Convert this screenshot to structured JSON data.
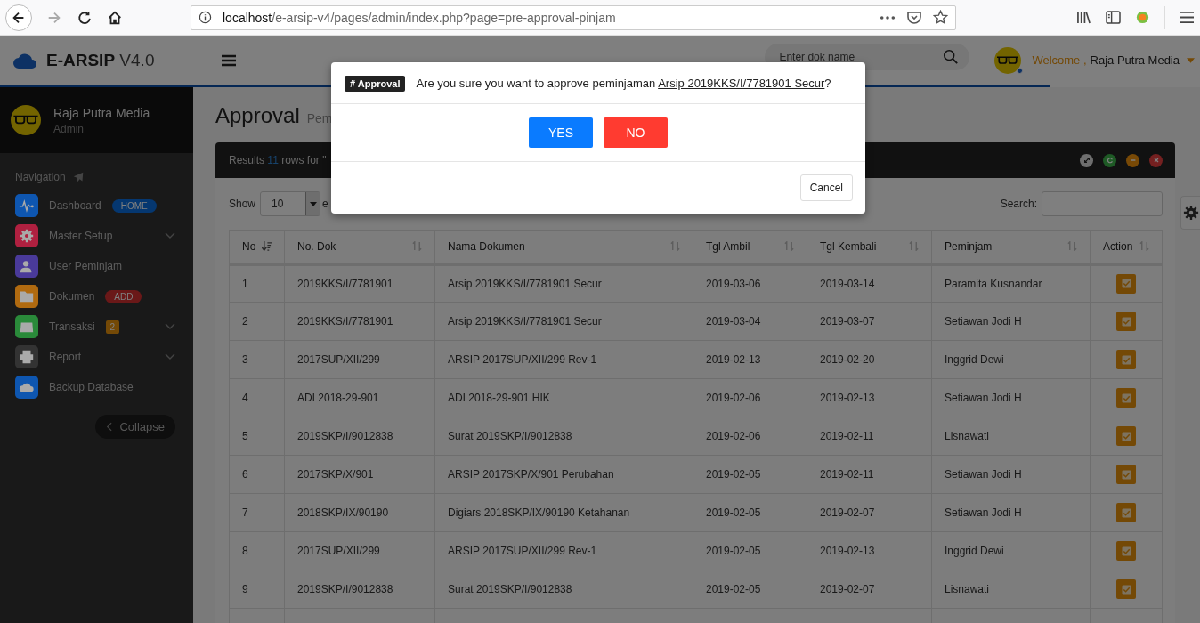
{
  "browser": {
    "url_host": "localhost",
    "url_path": "/e-arsip-v4/pages/admin/index.php?page=pre-approval-pinjam"
  },
  "header": {
    "logo": "E-ARSIP",
    "version": "V4.0",
    "search": {
      "placeholder": "Enter dok name"
    },
    "welcome": "Welcome ,",
    "user": "Raja Putra Media"
  },
  "sidebar": {
    "user": "Raja Putra Media",
    "role": "Admin",
    "heading": "Navigation",
    "items": [
      {
        "label": "Dashboard",
        "color": "#0e56b0",
        "badge": "HOME",
        "expandable": false
      },
      {
        "label": "Master Setup",
        "color": "#b02040",
        "expandable": true
      },
      {
        "label": "User Peminjam",
        "color": "#4a3a9a",
        "expandable": false
      },
      {
        "label": "Dokumen",
        "color": "#b06a10",
        "badge": "ADD",
        "expandable": false
      },
      {
        "label": "Transaksi",
        "color": "#2a8a3a",
        "badge": "2",
        "expandable": true
      },
      {
        "label": "Report",
        "color": "#333333",
        "expandable": true
      },
      {
        "label": "Backup Database",
        "color": "#0e56b0",
        "expandable": false
      }
    ],
    "collapse": "Collapse"
  },
  "page": {
    "title": "Approval",
    "subtitle": "Pem"
  },
  "panel": {
    "results_prefix": "Results",
    "results_count": "11",
    "results_suffix": "rows for \"",
    "show_label": "Show",
    "page_size": "10",
    "entries_label": "e",
    "search_label": "Search:"
  },
  "table": {
    "columns": [
      "No",
      "No. Dok",
      "Nama Dokumen",
      "Tgl Ambil",
      "Tgl Kembali",
      "Peminjam",
      "Action"
    ],
    "rows": [
      [
        "1",
        "2019KKS/I/7781901",
        "Arsip 2019KKS/I/7781901 Secur",
        "2019-03-06",
        "2019-03-14",
        "Paramita Kusnandar"
      ],
      [
        "2",
        "2019KKS/I/7781901",
        "Arsip 2019KKS/I/7781901 Secur",
        "2019-03-04",
        "2019-03-07",
        "Setiawan Jodi H"
      ],
      [
        "3",
        "2017SUP/XII/299",
        "ARSIP 2017SUP/XII/299 Rev-1",
        "2019-02-13",
        "2019-02-20",
        "Inggrid Dewi"
      ],
      [
        "4",
        "ADL2018-29-901",
        "ADL2018-29-901 HIK",
        "2019-02-06",
        "2019-02-13",
        "Setiawan Jodi H"
      ],
      [
        "5",
        "2019SKP/I/9012838",
        "Surat 2019SKP/I/9012838",
        "2019-02-06",
        "2019-02-11",
        "Lisnawati"
      ],
      [
        "6",
        "2017SKP/X/901",
        "ARSIP 2017SKP/X/901 Perubahan",
        "2019-02-05",
        "2019-02-11",
        "Setiawan Jodi H"
      ],
      [
        "7",
        "2018SKP/IX/90190",
        "Digiars 2018SKP/IX/90190 Ketahanan",
        "2019-02-05",
        "2019-02-07",
        "Setiawan Jodi H"
      ],
      [
        "8",
        "2017SUP/XII/299",
        "ARSIP 2017SUP/XII/299 Rev-1",
        "2019-02-05",
        "2019-02-13",
        "Inggrid Dewi"
      ],
      [
        "9",
        "2019SKP/I/9012838",
        "Surat 2019SKP/I/9012838",
        "2019-02-05",
        "2019-02-07",
        "Lisnawati"
      ]
    ]
  },
  "modal": {
    "tag": "# Approval",
    "message": "Are you sure you want to approve peminjaman",
    "link": "Arsip 2019KKS/I/7781901 Secur",
    "suffix": "?",
    "buttons": [
      {
        "label": "YES",
        "kind": "primary"
      },
      {
        "label": "NO",
        "kind": "danger"
      }
    ],
    "cancel": "Cancel"
  }
}
